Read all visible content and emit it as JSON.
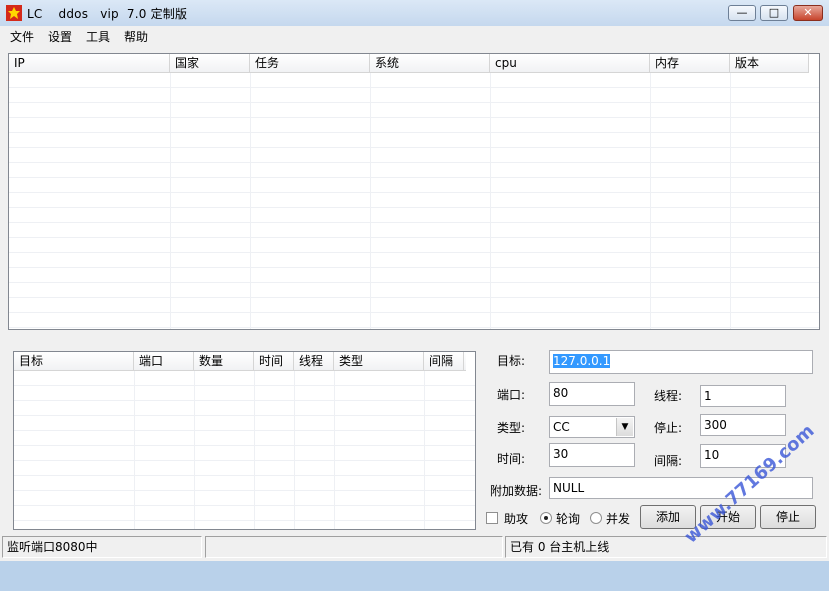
{
  "window": {
    "title": "LC    ddos   vip  7.0 定制版",
    "buttons": {
      "minimize": "—",
      "maximize": "□",
      "close": "✕"
    }
  },
  "menu": [
    "文件",
    "设置",
    "工具",
    "帮助"
  ],
  "host_list": {
    "columns": [
      "IP",
      "国家",
      "任务",
      "系统",
      "cpu",
      "内存",
      "版本"
    ],
    "rows": []
  },
  "task_list": {
    "columns": [
      "目标",
      "端口",
      "数量",
      "时间",
      "线程",
      "类型",
      "间隔"
    ],
    "rows": []
  },
  "form": {
    "target_label": "目标:",
    "target_value": "127.0.0.1",
    "port_label": "端口:",
    "port_value": "80",
    "threads_label": "线程:",
    "threads_value": "1",
    "type_label": "类型:",
    "type_value": "CC",
    "stop_label": "停止:",
    "stop_value": "300",
    "time_label": "时间:",
    "time_value": "30",
    "interval_label": "间隔:",
    "interval_value": "10",
    "extra_label": "附加数据:",
    "extra_value": "NULL",
    "assist_label": "助攻",
    "assist_checked": false,
    "mode_poll_label": "轮询",
    "mode_concurrent_label": "并发",
    "mode_selected": "轮询",
    "add_button": "添加",
    "start_button": "开始",
    "stop_button": "停止"
  },
  "status": {
    "listen": "监听端口8080中",
    "middle": "",
    "online": "已有 0 台主机上线"
  },
  "watermark": {
    "text": "www.77169.com"
  },
  "colors": {
    "titlebar": "#c5d8ee",
    "selection": "#3399ff",
    "close": "#c7442c"
  }
}
